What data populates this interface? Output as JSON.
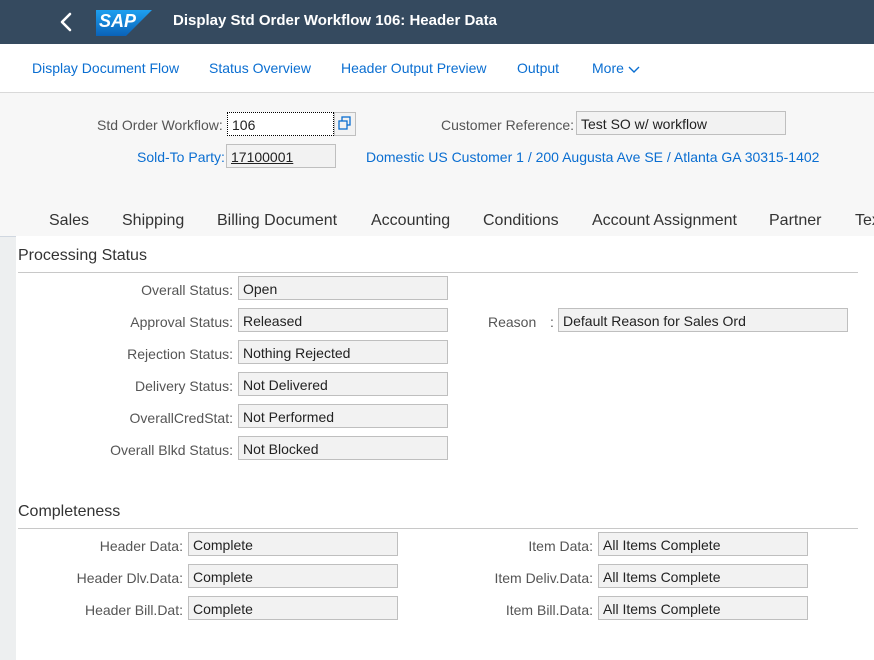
{
  "shell": {
    "title": "Display Std Order Workflow 106: Header Data",
    "logo_text": "SAP"
  },
  "toolbar": {
    "display_document_flow": "Display Document Flow",
    "status_overview": "Status Overview",
    "header_output_preview": "Header Output Preview",
    "output": "Output",
    "more": "More"
  },
  "header": {
    "std_order_label": "Std Order Workflow:",
    "std_order_value": "106",
    "customer_ref_label": "Customer Reference:",
    "customer_ref_value": "Test SO w/ workflow",
    "sold_to_label": "Sold-To Party:",
    "sold_to_value": "17100001",
    "sold_to_desc": "Domestic US Customer 1 / 200 Augusta Ave SE / Atlanta GA 30315-1402"
  },
  "tabs": [
    "Sales",
    "Shipping",
    "Billing Document",
    "Accounting",
    "Conditions",
    "Account Assignment",
    "Partner",
    "Texts"
  ],
  "processing": {
    "title": "Processing Status",
    "overall_label": "Overall Status:",
    "overall_value": "Open",
    "approval_label": "Approval Status:",
    "approval_value": "Released",
    "reason_label": "Reason",
    "reason_colon": ":",
    "reason_value": "Default Reason for Sales Ord",
    "rejection_label": "Rejection Status:",
    "rejection_value": "Nothing Rejected",
    "delivery_label": "Delivery Status:",
    "delivery_value": "Not Delivered",
    "credit_label": "OverallCredStat:",
    "credit_value": "Not Performed",
    "blocked_label": "Overall Blkd Status:",
    "blocked_value": "Not Blocked"
  },
  "completeness": {
    "title": "Completeness",
    "header_data_label": "Header Data:",
    "header_data_value": "Complete",
    "header_dlv_label": "Header Dlv.Data:",
    "header_dlv_value": "Complete",
    "header_bill_label": "Header Bill.Dat:",
    "header_bill_value": "Complete",
    "item_data_label": "Item Data:",
    "item_data_value": "All Items Complete",
    "item_deliv_label": "Item Deliv.Data:",
    "item_deliv_value": "All Items Complete",
    "item_bill_label": "Item Bill.Data:",
    "item_bill_value": "All Items Complete"
  }
}
